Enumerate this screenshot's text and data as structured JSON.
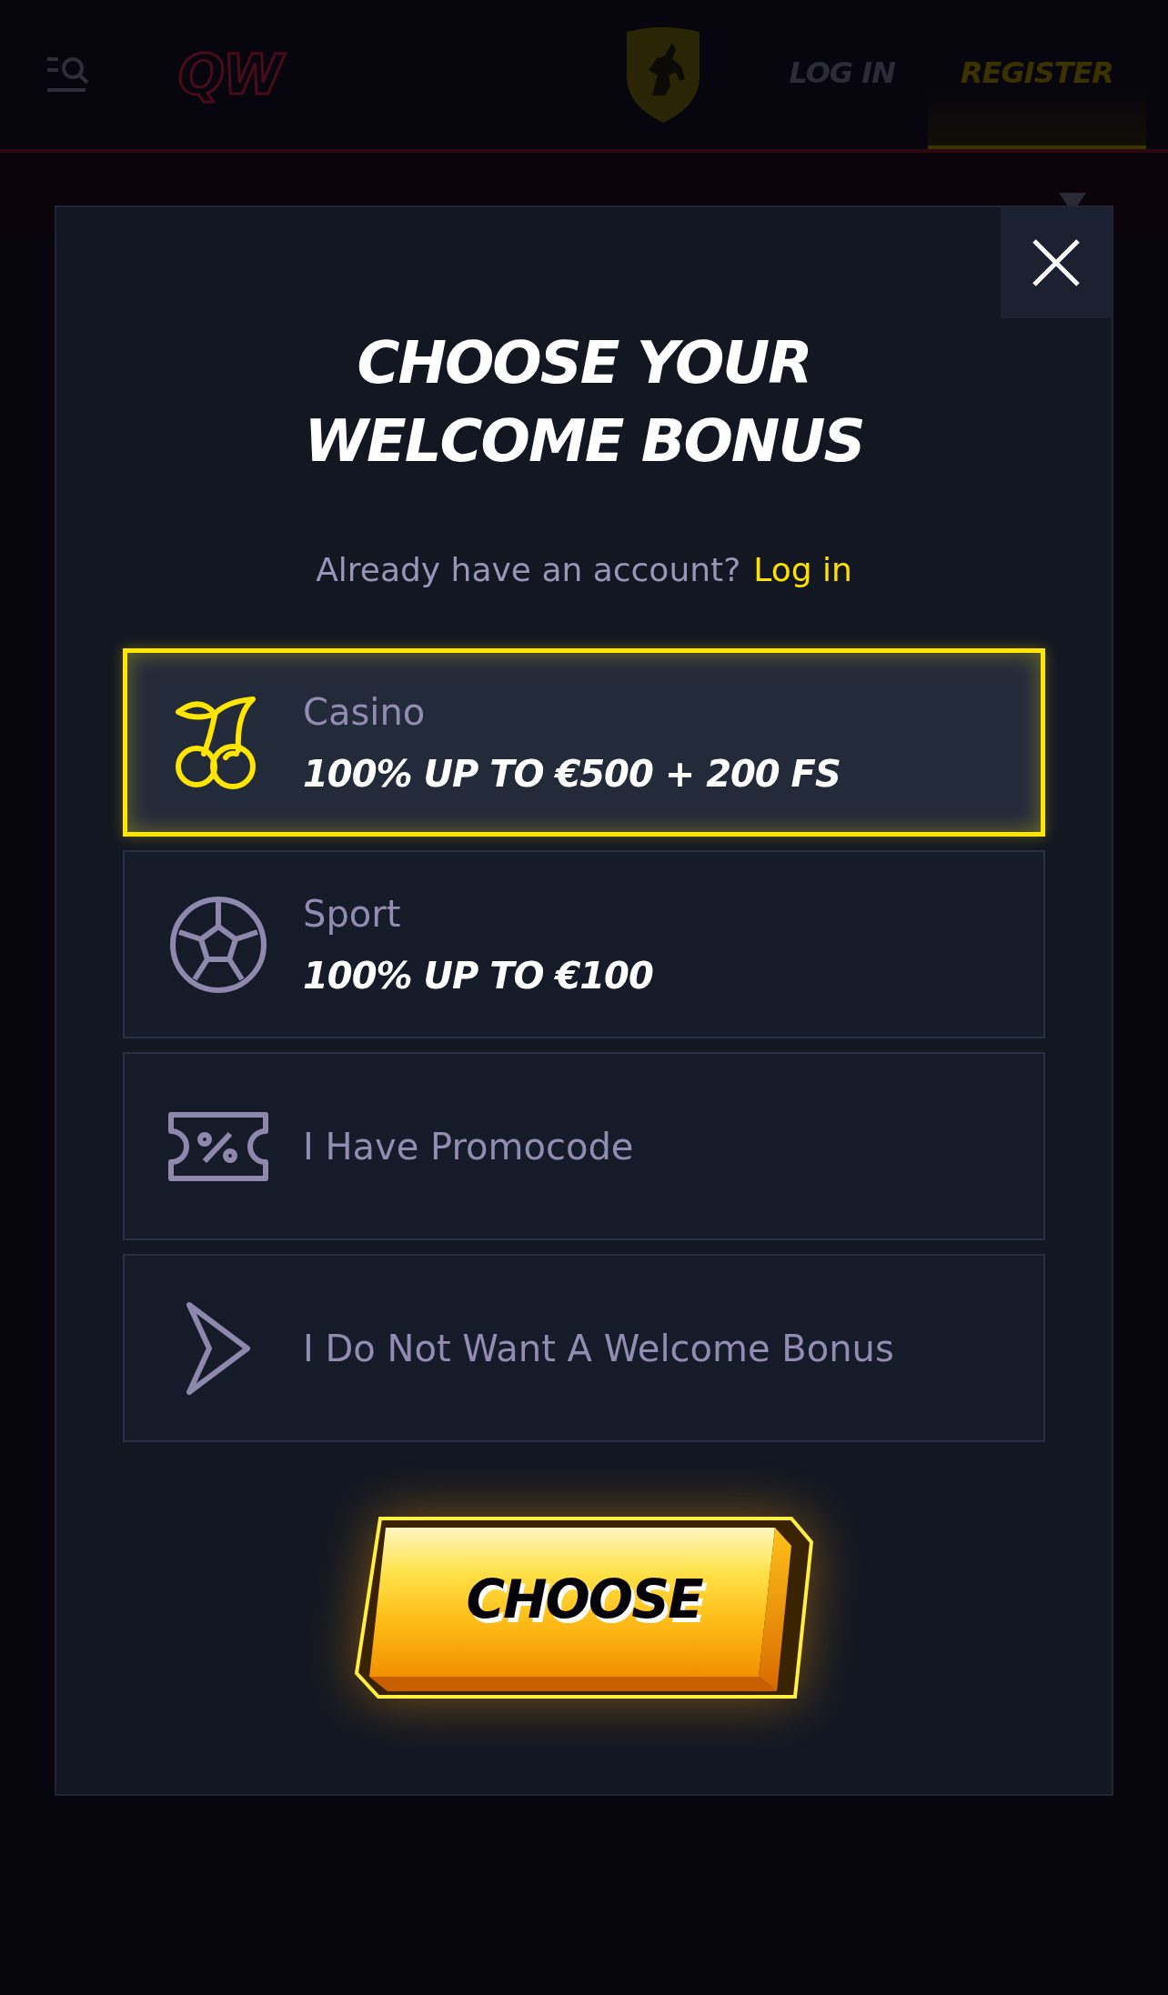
{
  "header": {
    "logo": "QW",
    "nav": [
      {
        "label": "LOG IN",
        "selected": false
      },
      {
        "label": "REGISTER",
        "selected": true
      }
    ]
  },
  "modal": {
    "title_lines": [
      "CHOOSE YOUR",
      "WELCOME BONUS"
    ],
    "login_prompt": "Already have an account?",
    "login_link": "Log in",
    "options": [
      {
        "kind": "cherries",
        "title": "Casino",
        "offer": "100% UP TO €500 + 200 FS",
        "selected": true
      },
      {
        "kind": "ball",
        "title": "Sport",
        "offer": "100% UP TO €100",
        "selected": false
      },
      {
        "kind": "ticket",
        "title": "I Have Promocode",
        "selected": false
      },
      {
        "kind": "chevron",
        "title": "I Do Not Want A Welcome Bonus",
        "selected": false
      }
    ],
    "button": "CHOOSE"
  }
}
